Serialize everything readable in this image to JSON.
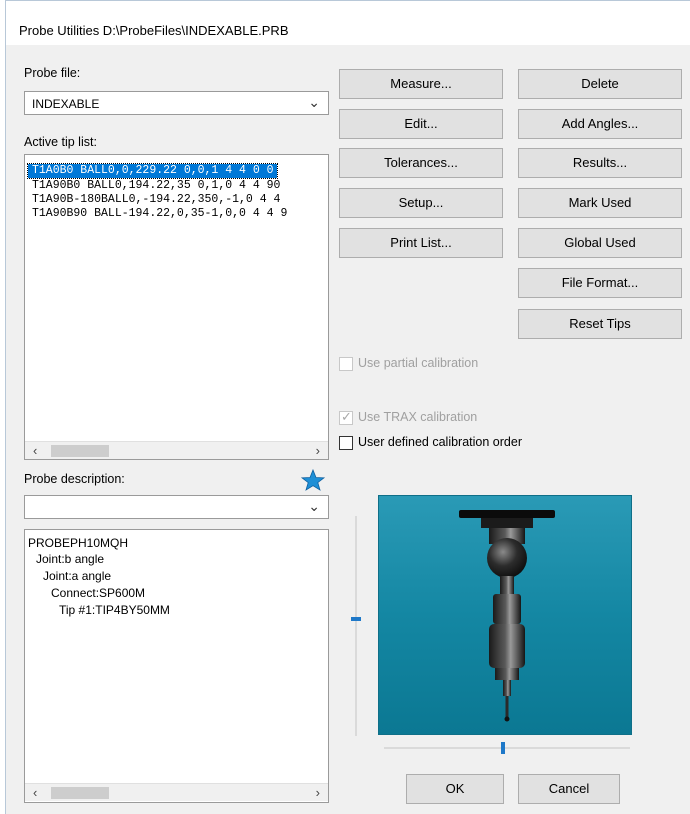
{
  "window": {
    "title": "Probe Utilities  D:\\ProbeFiles\\INDEXABLE.PRB"
  },
  "probe_file": {
    "label": "Probe file:",
    "value": "INDEXABLE"
  },
  "active_tips": {
    "label": "Active tip list:",
    "items": [
      "T1A0B0 BALL0,0,229.22 0,0,1 4 4 0 0",
      "T1A90B0 BALL0,194.22,35 0,1,0 4 4 90",
      "T1A90B-180BALL0,-194.22,350,-1,0 4 4",
      "T1A90B90 BALL-194.22,0,35-1,0,0 4 4 9"
    ],
    "selected_index": 0
  },
  "probe_description": {
    "label": "Probe description:",
    "value": "",
    "tree": [
      "PROBEPH10MQH",
      "Joint:b angle",
      "Joint:a angle",
      "Connect:SP600M",
      "Tip #1:TIP4BY50MM"
    ]
  },
  "buttons": {
    "measure": "Measure...",
    "delete": "Delete",
    "edit": "Edit...",
    "add_angles": "Add Angles...",
    "tolerances": "Tolerances...",
    "results": "Results...",
    "setup": "Setup...",
    "mark_used": "Mark Used",
    "print_list": "Print List...",
    "global_used": "Global Used",
    "file_format": "File Format...",
    "reset_tips": "Reset Tips",
    "ok": "OK",
    "cancel": "Cancel"
  },
  "checkboxes": {
    "partial_calibration": {
      "label": "Use partial calibration",
      "checked": false,
      "enabled": false
    },
    "trax_calibration": {
      "label": "Use TRAX calibration",
      "checked": true,
      "enabled": false
    },
    "user_defined_order": {
      "label": "User defined calibration order",
      "checked": false,
      "enabled": true
    }
  },
  "colors": {
    "selection": "#0078d7",
    "viewer_background": "#1487a3",
    "star": "#1e8fd6"
  },
  "icons": {
    "dropdown": "chevron-down-icon",
    "star": "star-icon",
    "scroll_left": "left-arrow-icon",
    "scroll_right": "right-arrow-icon"
  }
}
